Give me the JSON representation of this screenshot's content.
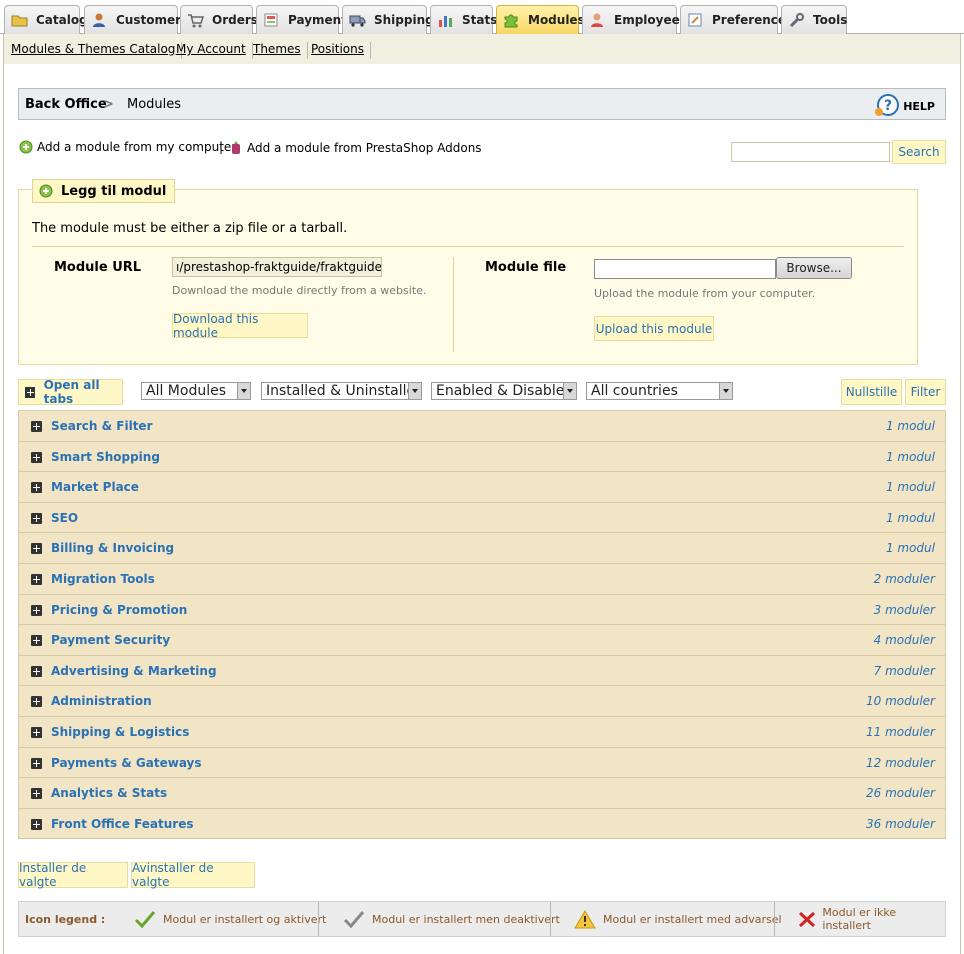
{
  "tabs": [
    {
      "label": "Catalog",
      "icon": "folder-icon"
    },
    {
      "label": "Customers",
      "icon": "customers-icon"
    },
    {
      "label": "Orders",
      "icon": "cart-icon"
    },
    {
      "label": "Payment",
      "icon": "payment-icon"
    },
    {
      "label": "Shipping",
      "icon": "truck-icon"
    },
    {
      "label": "Stats",
      "icon": "bar-chart-icon"
    },
    {
      "label": "Modules",
      "icon": "puzzle-icon",
      "active": true
    },
    {
      "label": "Employees",
      "icon": "employee-icon"
    },
    {
      "label": "Preferences",
      "icon": "preferences-icon"
    },
    {
      "label": "Tools",
      "icon": "wrench-icon"
    }
  ],
  "submenu": [
    "Modules & Themes Catalog",
    "My Account",
    "Themes",
    "Positions"
  ],
  "breadcrumb": {
    "root": "Back Office",
    "separator": ">",
    "current": "Modules",
    "help": "HELP"
  },
  "actions": {
    "add_from_computer": "Add a module from my computer",
    "separator": "|",
    "add_from_addons": "Add a module from PrestaShop Addons",
    "search_placeholder": "",
    "search_button": "Search"
  },
  "add_module": {
    "legend": "Legg til modul",
    "intro": "The module must be either a zip file or a tarball.",
    "url_label": "Module URL",
    "url_value": "ı/prestashop-fraktguide/fraktguide.zip",
    "url_hint": "Download the module directly from a website.",
    "download_button": "Download this module",
    "file_label": "Module file",
    "browse_button": "Browse...",
    "file_hint": "Upload the module from your computer.",
    "upload_button": "Upload this module"
  },
  "filters": {
    "open_all": "Open all tabs",
    "module_type": "All Modules",
    "install_state": "Installed & Uninstalled",
    "enable_state": "Enabled & Disabled",
    "country": "All countries",
    "reset_button": "Nullstille",
    "filter_button": "Filter"
  },
  "categories": [
    {
      "name": "Search & Filter",
      "count": "1 modul"
    },
    {
      "name": "Smart Shopping",
      "count": "1 modul"
    },
    {
      "name": "Market Place",
      "count": "1 modul"
    },
    {
      "name": "SEO",
      "count": "1 modul"
    },
    {
      "name": "Billing & Invoicing",
      "count": "1 modul"
    },
    {
      "name": "Migration Tools",
      "count": "2 moduler"
    },
    {
      "name": "Pricing & Promotion",
      "count": "3 moduler"
    },
    {
      "name": "Payment Security",
      "count": "4 moduler"
    },
    {
      "name": "Advertising & Marketing",
      "count": "7 moduler"
    },
    {
      "name": "Administration",
      "count": "10 moduler"
    },
    {
      "name": "Shipping & Logistics",
      "count": "11 moduler"
    },
    {
      "name": "Payments & Gateways",
      "count": "12 moduler"
    },
    {
      "name": "Analytics & Stats",
      "count": "26 moduler"
    },
    {
      "name": "Front Office Features",
      "count": "36 moduler"
    }
  ],
  "bulk": {
    "install": "Installer de valgte",
    "uninstall": "Avinstaller de valgte"
  },
  "icon_legend": {
    "title": "Icon legend :",
    "installed_active": "Modul er installert og aktivert",
    "installed_inactive": "Modul er installert men deaktivert",
    "installed_warning": "Modul er installert med advarsel",
    "not_installed": "Modul er ikke installert"
  },
  "colors": {
    "link": "#2a72b5",
    "category_bg": "#f2e5c6",
    "active_tab": "#f7d866",
    "button_bg": "#fff8c6"
  }
}
